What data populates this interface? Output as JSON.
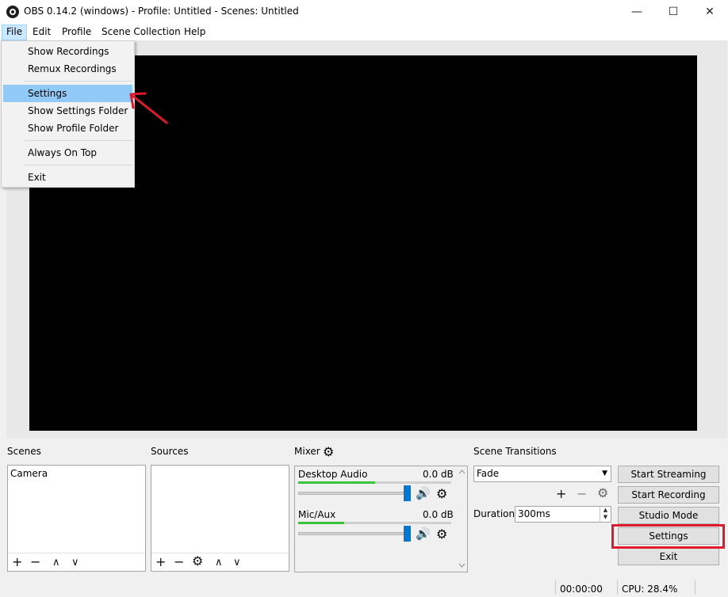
{
  "window": {
    "title": "OBS 0.14.2 (windows) - Profile: Untitled - Scenes: Untitled",
    "minimize_label": "—",
    "maximize_label": "☐",
    "close_label": "✕"
  },
  "menubar": {
    "items": [
      "File",
      "Edit",
      "Profile",
      "Scene Collection",
      "Help"
    ]
  },
  "file_menu": {
    "items": [
      "Show Recordings",
      "Remux Recordings",
      "Settings",
      "Show Settings Folder",
      "Show Profile Folder",
      "Always On Top",
      "Exit"
    ],
    "highlighted": "Settings"
  },
  "scenes": {
    "title": "Scenes",
    "items": [
      "Camera"
    ],
    "toolbar": [
      "+",
      "−",
      "∧",
      "∨"
    ]
  },
  "sources": {
    "title": "Sources",
    "items": [],
    "toolbar": [
      "+",
      "−",
      "⚙",
      "∧",
      "∨"
    ]
  },
  "mixer": {
    "title": "Mixer",
    "channels": [
      {
        "name": "Desktop Audio",
        "level": "0.0 dB",
        "meter_fill": 0.5
      },
      {
        "name": "Mic/Aux",
        "level": "0.0 dB",
        "meter_fill": 0.3
      }
    ],
    "speaker_glyph": "🔊",
    "gear_glyph": "⚙"
  },
  "transitions": {
    "title": "Scene Transitions",
    "selected": "Fade",
    "duration_label": "Duration",
    "duration_value": "300ms",
    "toolbar": [
      "+",
      "−",
      "⚙"
    ]
  },
  "controls": {
    "start_streaming": "Start Streaming",
    "start_recording": "Start Recording",
    "studio_mode": "Studio Mode",
    "settings": "Settings",
    "exit": "Exit"
  },
  "status": {
    "time": "00:00:00",
    "cpu": "CPU: 28.4%"
  },
  "colors": {
    "annotation": "#e0192c",
    "menu_highlight": "#91c9f7",
    "meter_green": "#3ac33a",
    "slider_blue": "#0078d7"
  }
}
